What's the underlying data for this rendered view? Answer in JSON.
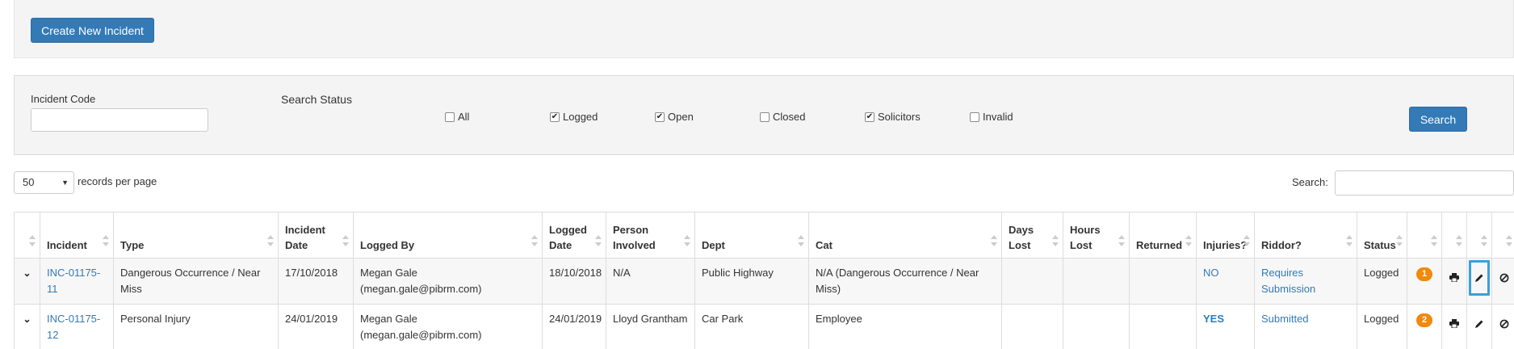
{
  "toolbar": {
    "create_label": "Create New Incident"
  },
  "search_panel": {
    "incident_code_label": "Incident Code",
    "incident_code_value": "",
    "search_status_label": "Search Status",
    "statuses": [
      {
        "label": "All",
        "checked": false
      },
      {
        "label": "Logged",
        "checked": true
      },
      {
        "label": "Open",
        "checked": true
      },
      {
        "label": "Closed",
        "checked": false
      },
      {
        "label": "Solicitors",
        "checked": true
      },
      {
        "label": "Invalid",
        "checked": false
      }
    ],
    "search_button": "Search"
  },
  "list_controls": {
    "page_length": "50",
    "records_label": "records per page",
    "search_label": "Search:",
    "search_value": ""
  },
  "table": {
    "headers": {
      "incident": "Incident",
      "type": "Type",
      "incident_date": "Incident Date",
      "logged_by": "Logged By",
      "logged_date": "Logged Date",
      "person_involved": "Person Involved",
      "dept": "Dept",
      "cat": "Cat",
      "days_lost": "Days Lost",
      "hours_lost": "Hours Lost",
      "returned": "Returned",
      "injuries": "Injuries?",
      "riddor": "Riddor?",
      "status": "Status"
    },
    "rows": [
      {
        "incident": "INC-01175-11",
        "type": "Dangerous Occurrence / Near Miss",
        "incident_date": "17/10/2018",
        "logged_by": "Megan Gale (megan.gale@pibrm.com)",
        "logged_date": "18/10/2018",
        "person_involved": "N/A",
        "dept": "Public Highway",
        "cat": "N/A (Dangerous Occurrence / Near Miss)",
        "days_lost": "",
        "hours_lost": "",
        "returned": "",
        "injuries": "NO",
        "riddor": "Requires Submission",
        "status": "Logged",
        "count": "1"
      },
      {
        "incident": "INC-01175-12",
        "type": "Personal Injury",
        "incident_date": "24/01/2019",
        "logged_by": "Megan Gale (megan.gale@pibrm.com)",
        "logged_date": "24/01/2019",
        "person_involved": "Lloyd Grantham",
        "dept": "Car Park",
        "cat": "Employee",
        "days_lost": "",
        "hours_lost": "",
        "returned": "",
        "injuries": "YES",
        "riddor": "Submitted",
        "status": "Logged",
        "count": "2"
      }
    ]
  },
  "icons": [
    "chevron-down-icon",
    "print-icon",
    "pencil-icon",
    "ban-icon",
    "sort-icon"
  ],
  "colors": {
    "primary": "#337ab7",
    "badge": "#f0890d",
    "highlight": "#3aa0d8"
  }
}
